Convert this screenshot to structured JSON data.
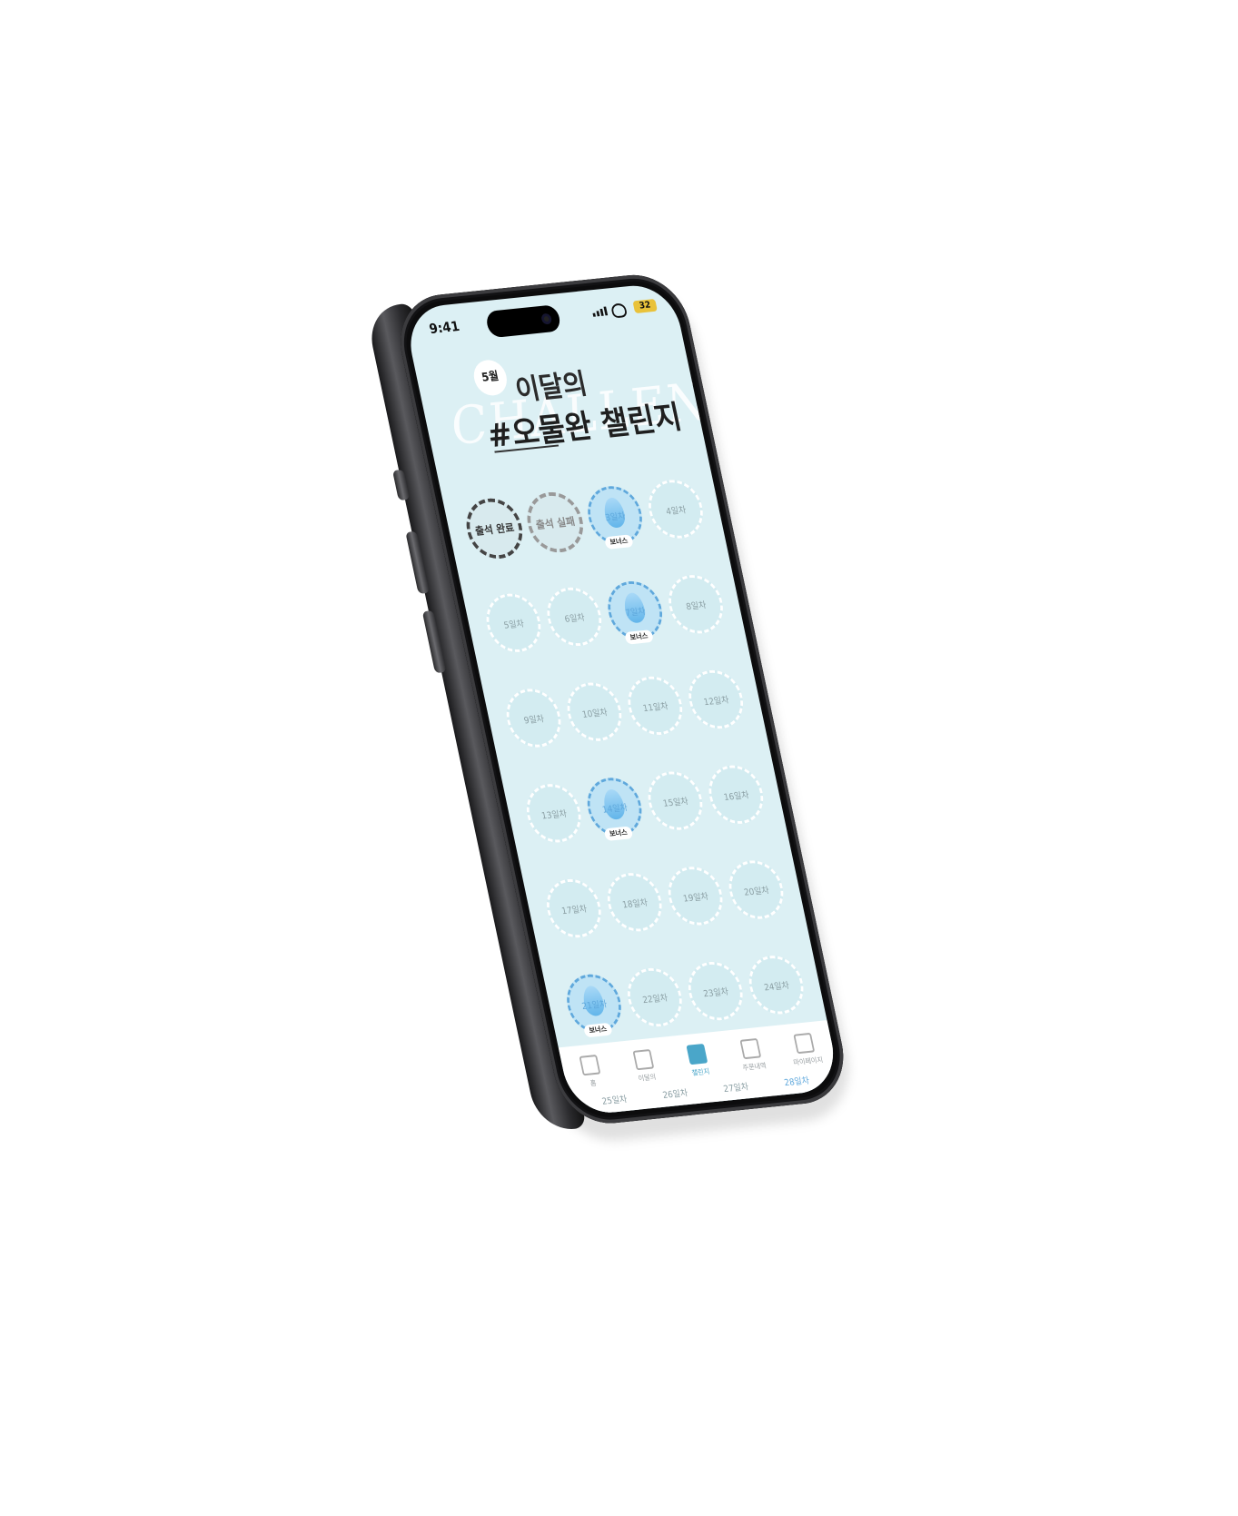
{
  "status_bar": {
    "time": "9:41",
    "battery": "32"
  },
  "header": {
    "month": "5월",
    "title_small": "이달의",
    "title_big": "#오물완 챌린지",
    "background_word": "CHALLENGE"
  },
  "days": [
    {
      "label": "출석 완료",
      "state": "done"
    },
    {
      "label": "출석 실패",
      "state": "fail"
    },
    {
      "label": "3일차",
      "state": "bonus",
      "tag": "보너스"
    },
    {
      "label": "4일차",
      "state": "empty"
    },
    {
      "label": "5일차",
      "state": "empty"
    },
    {
      "label": "6일차",
      "state": "empty"
    },
    {
      "label": "7일차",
      "state": "bonus",
      "tag": "보너스"
    },
    {
      "label": "8일차",
      "state": "empty"
    },
    {
      "label": "9일차",
      "state": "empty"
    },
    {
      "label": "10일차",
      "state": "empty"
    },
    {
      "label": "11일차",
      "state": "empty"
    },
    {
      "label": "12일차",
      "state": "empty"
    },
    {
      "label": "13일차",
      "state": "empty"
    },
    {
      "label": "14일차",
      "state": "bonus",
      "tag": "보너스"
    },
    {
      "label": "15일차",
      "state": "empty"
    },
    {
      "label": "16일차",
      "state": "empty"
    },
    {
      "label": "17일차",
      "state": "empty"
    },
    {
      "label": "18일차",
      "state": "empty"
    },
    {
      "label": "19일차",
      "state": "empty"
    },
    {
      "label": "20일차",
      "state": "empty"
    },
    {
      "label": "21일차",
      "state": "bonus",
      "tag": "보너스"
    },
    {
      "label": "22일차",
      "state": "empty"
    },
    {
      "label": "23일차",
      "state": "empty"
    },
    {
      "label": "24일차",
      "state": "empty"
    },
    {
      "label": "25일차",
      "state": "empty"
    },
    {
      "label": "26일차",
      "state": "empty"
    },
    {
      "label": "27일차",
      "state": "empty"
    },
    {
      "label": "28일차",
      "state": "bonus"
    }
  ],
  "tabbar": [
    {
      "label": "홈",
      "icon": "home-icon",
      "active": false
    },
    {
      "label": "이달의",
      "icon": "chat-icon",
      "active": false
    },
    {
      "label": "챌린지",
      "icon": "check-icon",
      "active": true
    },
    {
      "label": "주문내역",
      "icon": "cart-icon",
      "active": false
    },
    {
      "label": "마이페이지",
      "icon": "user-icon",
      "active": false
    }
  ],
  "colors": {
    "screen_bg": "#dcf0f4",
    "bonus_blue": "#5fa8dc",
    "accent": "#4aa6c9"
  }
}
